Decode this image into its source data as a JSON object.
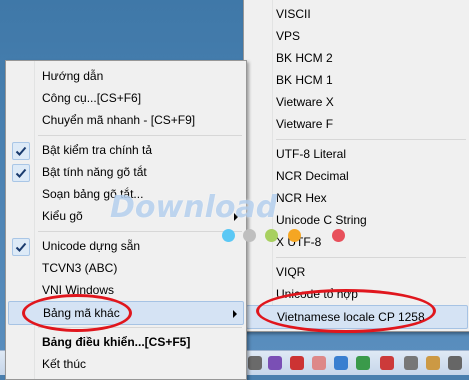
{
  "main_menu": {
    "items": [
      {
        "label": "Hướng dẫn"
      },
      {
        "label": "Công cụ...[CS+F6]"
      },
      {
        "label": "Chuyển mã nhanh - [CS+F9]"
      },
      {
        "label": "Bật kiểm tra chính tả",
        "checked": true
      },
      {
        "label": "Bật tính năng gõ tắt",
        "checked": true
      },
      {
        "label": "Soạn bảng gõ tắt..."
      },
      {
        "label": "Kiểu gõ",
        "submenu": true
      },
      {
        "label": "Unicode dựng sẵn",
        "checked": true
      },
      {
        "label": "TCVN3 (ABC)"
      },
      {
        "label": "VNI Windows"
      },
      {
        "label": "Bảng mã khác",
        "submenu": true,
        "highlighted": true
      },
      {
        "label": "Bảng điều khiển...[CS+F5]",
        "bold": true
      },
      {
        "label": "Kết thúc"
      }
    ]
  },
  "sub_menu": {
    "items": [
      {
        "label": "VISCII"
      },
      {
        "label": "VPS"
      },
      {
        "label": "BK HCM 2"
      },
      {
        "label": "BK HCM 1"
      },
      {
        "label": "Vietware X"
      },
      {
        "label": "Vietware F"
      },
      {
        "label": "UTF-8 Literal"
      },
      {
        "label": "NCR Decimal"
      },
      {
        "label": "NCR Hex"
      },
      {
        "label": "Unicode C String"
      },
      {
        "label": "X UTF-8"
      },
      {
        "label": "VIQR"
      },
      {
        "label": "Unicode tổ hợp"
      },
      {
        "label": "Vietnamese locale CP 1258",
        "highlighted": true
      }
    ]
  },
  "watermark": {
    "text": "Download"
  },
  "colors": {
    "highlight_ellipse": "#e0161d",
    "dots": [
      "#5bc8f5",
      "#bfbfbf",
      "#a8d060",
      "#f5a623",
      "#e8505b"
    ]
  }
}
